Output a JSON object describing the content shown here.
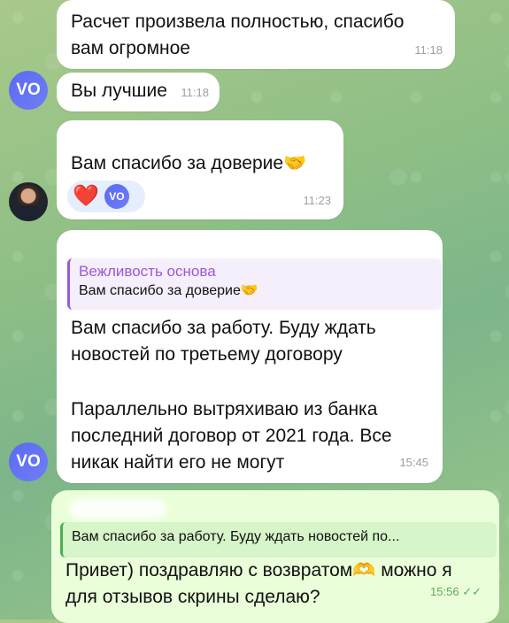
{
  "messages": [
    {
      "text": "Расчет произвела полностью, спасибо вам огромное",
      "time": "11:18"
    },
    {
      "sender_initials": "VO",
      "text": "Вы лучшие",
      "time": "11:18"
    },
    {
      "text": "Вам спасибо за доверие🤝",
      "time": "11:23",
      "reaction": {
        "emoji": "❤️",
        "user_initials": "VO"
      }
    },
    {
      "sender_initials": "VO",
      "reply": {
        "author": "Вежливость основа",
        "text": "Вам спасибо за доверие🤝"
      },
      "text_para1": "Вам спасибо за работу. Буду ждать новостей по третьему  договору",
      "text_para2": "Параллельно вытряхиваю из банка последний договор от 2021 года. Все никак найти его не могут",
      "time": "15:45"
    },
    {
      "reply": {
        "text": "Вам спасибо за работу. Буду ждать новостей по..."
      },
      "text": "Привет) поздравляю с возвратом🫶 можно я для отзывов скрины сделаю?",
      "time": "15:56",
      "status": "✓✓"
    }
  ],
  "colors": {
    "incoming_bg": "#ffffff",
    "outgoing_bg": "#eaffd9",
    "avatar": "#5b6bf0",
    "reply_accent": "#9b59d6"
  }
}
